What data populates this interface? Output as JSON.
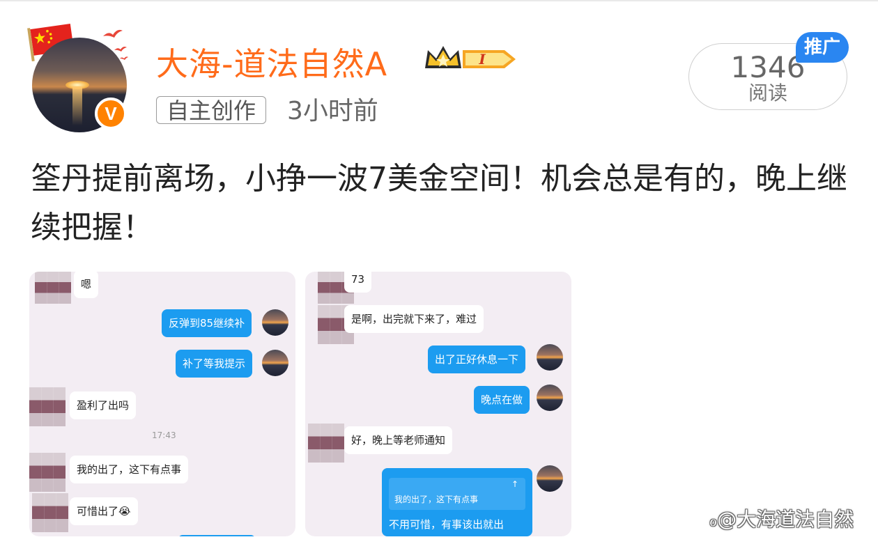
{
  "header": {
    "username": "大海-道法自然A",
    "tag": "自主创作",
    "time": "3小时前",
    "read_count": "1346",
    "read_label": "阅读",
    "promo_badge": "推广",
    "verified_mark": "V",
    "level_badge": "I"
  },
  "post": {
    "text": "筌丹提前离场，小挣一波7美金空间！机会总是有的，晚上继续把握！"
  },
  "chat_left": {
    "messages": [
      {
        "side": "left",
        "text": "嗯"
      },
      {
        "side": "right",
        "text": "反弹到85继续补"
      },
      {
        "side": "right",
        "text": "补了等我提示"
      },
      {
        "side": "left",
        "text": "盈利了出吗"
      },
      {
        "side": "left",
        "text": "我的出了，这下有点事"
      },
      {
        "side": "left",
        "text": "可惜出了😭"
      }
    ],
    "timestamp": "17:43"
  },
  "chat_right": {
    "messages": [
      {
        "side": "left",
        "text": "73"
      },
      {
        "side": "left",
        "text": "是啊，出完就下来了，难过"
      },
      {
        "side": "right",
        "text": "出了正好休息一下"
      },
      {
        "side": "right",
        "text": "晚点在做"
      },
      {
        "side": "left",
        "text": "好，晚上等老师通知"
      }
    ],
    "quoted": "我的出了，这下有点事",
    "quote_arrow": "↑",
    "reply": "不用可惜，有事该出就出"
  },
  "watermark": "@大海道法自然",
  "colors": {
    "username": "#ff6b1a",
    "verified": "#ff8200",
    "promo": "#2a86f1",
    "bubble_blue": "#1c9cf0",
    "panel_bg": "#f3edf3"
  },
  "icons": [
    "china-flag-icon",
    "bird-icon",
    "crown-icon",
    "verified-icon",
    "weibo-icon"
  ]
}
